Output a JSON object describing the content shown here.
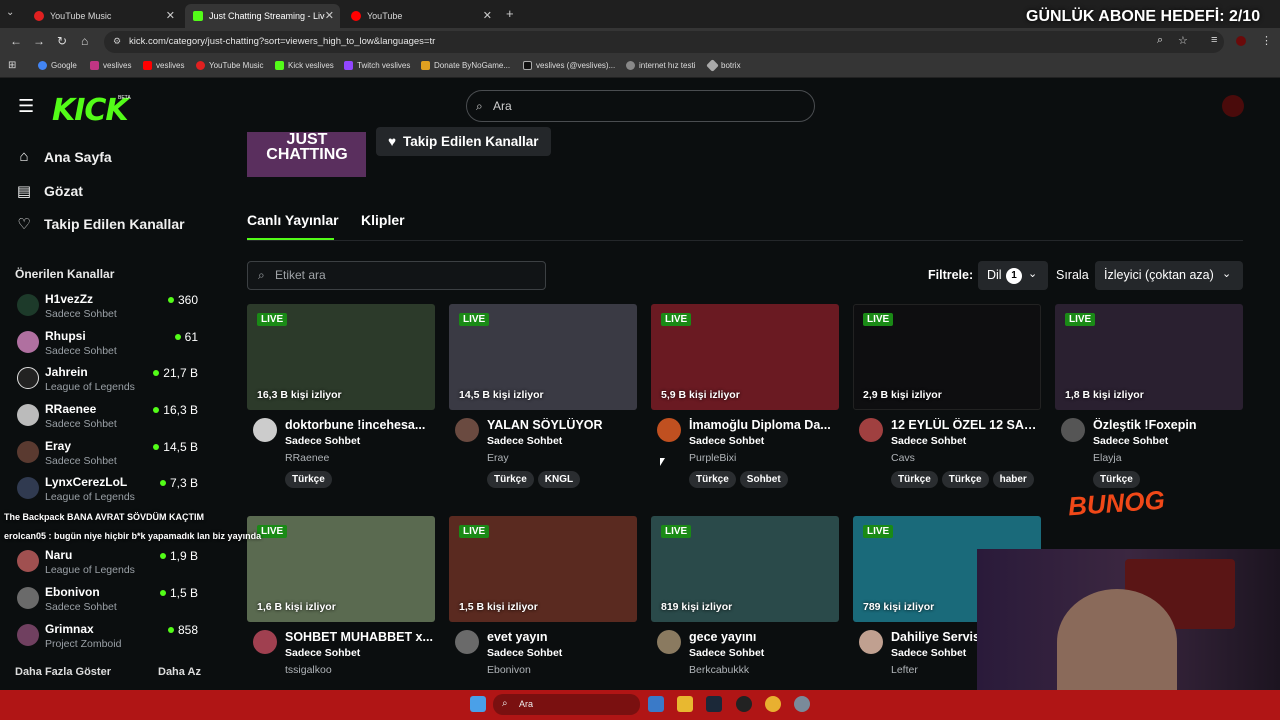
{
  "browser": {
    "tabs": [
      {
        "label": "YouTube Music",
        "color": "#e02020"
      },
      {
        "label": "Just Chatting Streaming - Live",
        "color": "#53fc18"
      },
      {
        "label": "YouTube",
        "color": "#ff0000"
      }
    ],
    "new_tab": "+",
    "url": "kick.com/category/just-chatting?sort=viewers_high_to_low&languages=tr",
    "bookmarks": [
      "Google",
      "veslives",
      "veslives",
      "YouTube Music",
      "Kick veslives",
      "Twitch veslives",
      "Donate ByNoGame...",
      "veslives (@veslives)...",
      "internet hız testi",
      "botrix"
    ]
  },
  "overlay": {
    "goal": "GÜNLÜK ABONE HEDEFİ: 2/10",
    "chat": [
      "The Backpack BANA AVRAT SÖVDÜM KAÇTIM",
      "erolcan05 : bugün niye hiçbir b*k yapamadık lan biz yayında"
    ],
    "watermark": "BUNOG"
  },
  "header": {
    "logo": "KICK",
    "beta": "BETA",
    "search_placeholder": "Ara",
    "brand_color": "#53fc18"
  },
  "sidebar": {
    "nav": [
      {
        "label": "Ana Sayfa",
        "icon": "home-icon"
      },
      {
        "label": "Gözat",
        "icon": "browse-icon"
      },
      {
        "label": "Takip Edilen Kanallar",
        "icon": "heart-icon"
      }
    ],
    "recommended_title": "Önerilen Kanallar",
    "channels": [
      {
        "name": "H1vezZz",
        "category": "Sadece Sohbet",
        "viewers": "360"
      },
      {
        "name": "Rhupsi",
        "category": "Sadece Sohbet",
        "viewers": "61"
      },
      {
        "name": "Jahrein",
        "category": "League of Legends",
        "viewers": "21,7 B"
      },
      {
        "name": "RRaenee",
        "category": "Sadece Sohbet",
        "viewers": "16,3 B"
      },
      {
        "name": "Eray",
        "category": "Sadece Sohbet",
        "viewers": "14,5 B"
      },
      {
        "name": "LynxCerezLoL",
        "category": "League of Legends",
        "viewers": "7,3 B"
      },
      {
        "name": "Naru",
        "category": "League of Legends",
        "viewers": "1,9 B"
      },
      {
        "name": "Ebonivon",
        "category": "Sadece Sohbet",
        "viewers": "1,5 B"
      },
      {
        "name": "Grimnax",
        "category": "Project Zomboid",
        "viewers": "858"
      }
    ],
    "show_more": "Daha Fazla Göster",
    "show_less": "Daha Az"
  },
  "main": {
    "banner": "JUST CHATTING",
    "follow_button": "Takip Edilen Kanallar",
    "tabs": [
      "Canlı Yayınlar",
      "Klipler"
    ],
    "tag_search_placeholder": "Etiket ara",
    "filter_label": "Filtrele:",
    "language_label": "Dil",
    "language_count": "1",
    "sort_label": "Sırala",
    "sort_value": "İzleyici (çoktan aza)",
    "live_label": "LIVE",
    "streams": [
      {
        "viewers": "16,3 B kişi izliyor",
        "title": "doktorbune !incehesa...",
        "category": "Sadece Sohbet",
        "user": "RRaenee",
        "tags": [
          "Türkçe"
        ],
        "thumb": "#2c3a2a"
      },
      {
        "viewers": "14,5 B kişi izliyor",
        "title": "YALAN SÖYLÜYOR",
        "category": "Sadece Sohbet",
        "user": "Eray",
        "tags": [
          "Türkçe",
          "KNGL"
        ],
        "thumb": "#3a3a44"
      },
      {
        "viewers": "5,9 B kişi izliyor",
        "title": "İmamoğlu Diploma Da...",
        "category": "Sadece Sohbet",
        "user": "PurpleBixi",
        "tags": [
          "Türkçe",
          "Sohbet"
        ],
        "thumb": "#6a1a22"
      },
      {
        "viewers": "2,9 B kişi izliyor",
        "title": "12 EYLÜL ÖZEL 12 SAA...",
        "category": "Sadece Sohbet",
        "user": "Cavs",
        "tags": [
          "Türkçe",
          "Türkçe",
          "haber"
        ],
        "thumb": "#0e0e10"
      },
      {
        "viewers": "1,8 B kişi izliyor",
        "title": "Özleştik !Foxepin",
        "category": "Sadece Sohbet",
        "user": "Elayja",
        "tags": [
          "Türkçe"
        ],
        "thumb": "#2a2030"
      },
      {
        "viewers": "1,6 B kişi izliyor",
        "title": "SOHBET MUHABBET x...",
        "category": "Sadece Sohbet",
        "user": "tssigalkoo",
        "tags": [],
        "thumb": "#5a6a50"
      },
      {
        "viewers": "1,5 B kişi izliyor",
        "title": "evet yayın",
        "category": "Sadece Sohbet",
        "user": "Ebonivon",
        "tags": [],
        "thumb": "#5a2a20"
      },
      {
        "viewers": "819 kişi izliyor",
        "title": "gece yayını",
        "category": "Sadece Sohbet",
        "user": "Berkcabukkk",
        "tags": [],
        "thumb": "#2a4a4a"
      },
      {
        "viewers": "789 kişi izliyor",
        "title": "Dahiliye Servisi",
        "category": "Sadece Sohbet",
        "user": "Lefter",
        "tags": [],
        "thumb": "#1a6a7a"
      }
    ]
  },
  "taskbar": {
    "search_placeholder": "Ara",
    "color": "#b01515"
  }
}
